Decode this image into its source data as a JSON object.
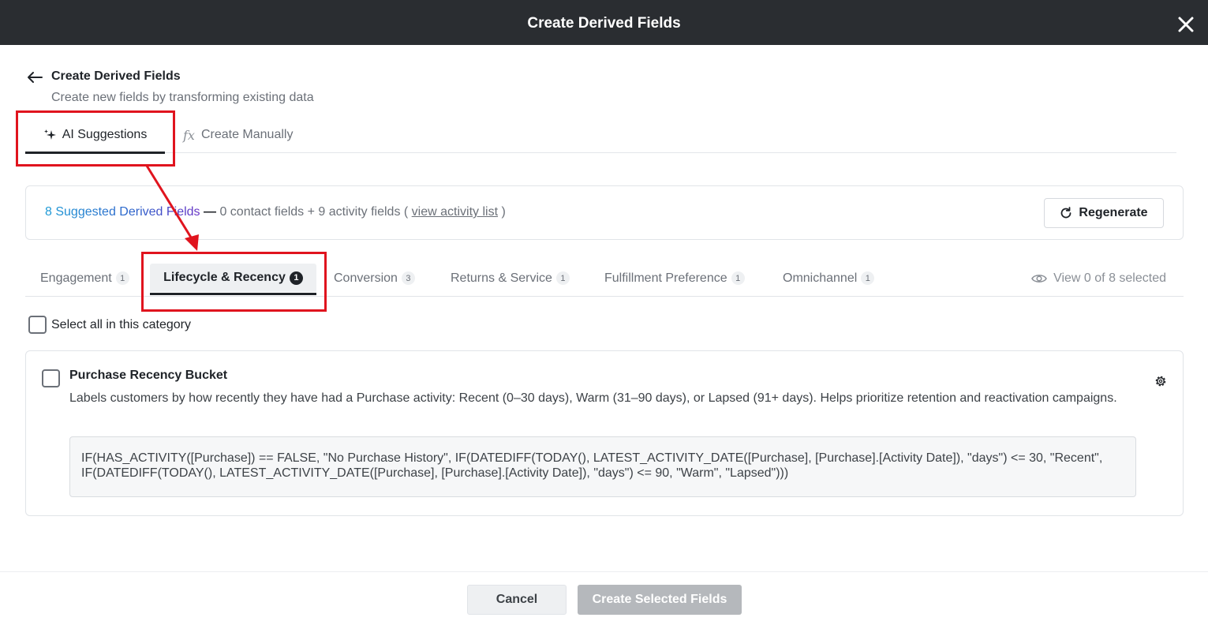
{
  "modal": {
    "title": "Create Derived Fields",
    "close_icon": "close-icon"
  },
  "header": {
    "title": "Create Derived Fields",
    "subtitle": "Create new fields by transforming existing data"
  },
  "mode_tabs": [
    {
      "label": "AI Suggestions",
      "icon": "sparkle-icon",
      "active": true
    },
    {
      "label": "Create Manually",
      "icon": "fx-icon",
      "icon_text": "fx",
      "active": false
    }
  ],
  "summary": {
    "count_text": "8 Suggested Derived Fields",
    "dash": " — ",
    "detail": "0 contact fields + 9 activity fields ( ",
    "link": "view activity list",
    "close_paren": " )",
    "regenerate_label": "Regenerate"
  },
  "category_tabs": [
    {
      "label": "Engagement",
      "count": "1",
      "active": false
    },
    {
      "label": "Lifecycle & Recency",
      "count": "1",
      "active": true
    },
    {
      "label": "Conversion",
      "count": "3",
      "active": false
    },
    {
      "label": "Returns & Service",
      "count": "1",
      "active": false
    },
    {
      "label": "Fulfillment Preference",
      "count": "1",
      "active": false
    },
    {
      "label": "Omnichannel",
      "count": "1",
      "active": false
    }
  ],
  "view_selected": "View 0 of 8 selected",
  "select_all_label": "Select all in this category",
  "card": {
    "title": "Purchase Recency Bucket",
    "description": "Labels customers by how recently they have had a Purchase activity: Recent (0–30 days), Warm (31–90 days), or Lapsed (91+ days). Helps prioritize retention and reactivation campaigns.",
    "formula": "IF(HAS_ACTIVITY([Purchase]) == FALSE, \"No Purchase History\", IF(DATEDIFF(TODAY(), LATEST_ACTIVITY_DATE([Purchase], [Purchase].[Activity Date]), \"days\") <= 30, \"Recent\", IF(DATEDIFF(TODAY(), LATEST_ACTIVITY_DATE([Purchase], [Purchase].[Activity Date]), \"days\") <= 90, \"Warm\", \"Lapsed\")))"
  },
  "footer": {
    "cancel_label": "Cancel",
    "create_label": "Create Selected Fields"
  },
  "colors": {
    "topbar": "#2a2d31",
    "annotation": "#e0141e",
    "gradient_start": "#1d9bd6",
    "gradient_end": "#6a34c6",
    "disabled_button": "#b5b8bc"
  }
}
